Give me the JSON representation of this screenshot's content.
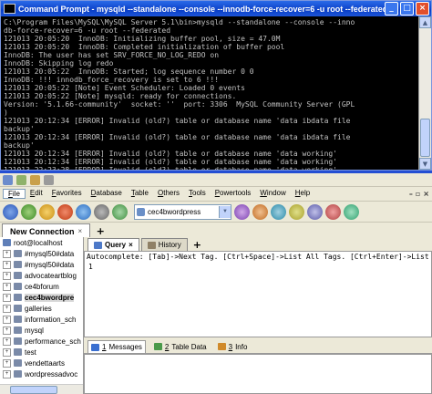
{
  "cmd": {
    "title": "Command Prompt - mysqld  --standalone --console --innodb-force-recover=6 -u root --federated",
    "lines": [
      "C:\\Program Files\\MySQL\\MySQL Server 5.1\\bin>mysqld --standalone --console --inno",
      "db-force-recover=6 -u root --federated",
      "121013 20:05:20  InnoDB: Initializing buffer pool, size = 47.0M",
      "121013 20:05:20  InnoDB: Completed initialization of buffer pool",
      "InnoDB: The user has set SRV_FORCE_NO_LOG_REDO on",
      "InnoDB: Skipping log redo",
      "121013 20:05:22  InnoDB: Started; log sequence number 0 0",
      "InnoDB: !!! innodb_force_recovery is set to 6 !!!",
      "121013 20:05:22 [Note] Event Scheduler: Loaded 0 events",
      "121013 20:05:22 [Note] mysqld: ready for connections.",
      "Version: '5.1.66-community'  socket: ''  port: 3306  MySQL Community Server (GPL",
      ")",
      "121013 20:12:34 [ERROR] Invalid (old?) table or database name 'data ibdata file",
      "backup'",
      "121013 20:12:34 [ERROR] Invalid (old?) table or database name 'data ibdata file",
      "backup'",
      "121013 20:12:34 [ERROR] Invalid (old?) table or database name 'data working'",
      "121013 20:12:34 [ERROR] Invalid (old?) table or database name 'data working'",
      "121013 22:23:28 [ERROR] Invalid (old?) table or database name 'data working'"
    ],
    "buttons": {
      "minimize": "_",
      "maximize": "□",
      "close": "×"
    }
  },
  "menu": {
    "items": [
      {
        "label": "File",
        "u": "F",
        "rest": "ile"
      },
      {
        "label": "Edit",
        "u": "E",
        "rest": "dit"
      },
      {
        "label": "Favorites",
        "u": "F",
        "rest": "avorites"
      },
      {
        "label": "Database",
        "u": "D",
        "rest": "atabase"
      },
      {
        "label": "Table",
        "u": "T",
        "rest": "able"
      },
      {
        "label": "Others",
        "u": "O",
        "rest": "thers"
      },
      {
        "label": "Tools",
        "u": "T",
        "rest": "ools"
      },
      {
        "label": "Powertools",
        "u": "P",
        "rest": "owertools"
      },
      {
        "label": "Window",
        "u": "W",
        "rest": "indow"
      },
      {
        "label": "Help",
        "u": "H",
        "rest": "elp"
      }
    ],
    "window_controls": {
      "minimize": "–",
      "restore": "▫",
      "close": "×"
    }
  },
  "toolbar": {
    "selected_database": "cec4bwordpress"
  },
  "connection_tab": {
    "label": "New Connection",
    "close": "×",
    "add": "+"
  },
  "object_browser": {
    "root": "root@localhost",
    "items": [
      {
        "label": "#mysql50#data",
        "selected": false
      },
      {
        "label": "#mysql50#data",
        "selected": false
      },
      {
        "label": "advocateartblog",
        "selected": false
      },
      {
        "label": "ce4bforum",
        "selected": false
      },
      {
        "label": "cec4bwordpre",
        "selected": true
      },
      {
        "label": "galleries",
        "selected": false
      },
      {
        "label": "information_sch",
        "selected": false
      },
      {
        "label": "mysql",
        "selected": false
      },
      {
        "label": "performance_sch",
        "selected": false
      },
      {
        "label": "test",
        "selected": false
      },
      {
        "label": "vendettaarts",
        "selected": false
      },
      {
        "label": "wordpressadvoc",
        "selected": false
      }
    ],
    "expand_symbol": "+"
  },
  "query_tabs": {
    "query": "Query",
    "history": "History",
    "query_close": "×",
    "add": "+"
  },
  "editor": {
    "autocomplete": "Autocomplete: [Tab]->Next Tag. [Ctrl+Space]->List All Tags. [Ctrl+Enter]->List Matching",
    "line_number": "1"
  },
  "result_tabs": [
    {
      "num": "1",
      "label": "Messages"
    },
    {
      "num": "2",
      "label": "Table Data"
    },
    {
      "num": "3",
      "label": "Info"
    }
  ]
}
